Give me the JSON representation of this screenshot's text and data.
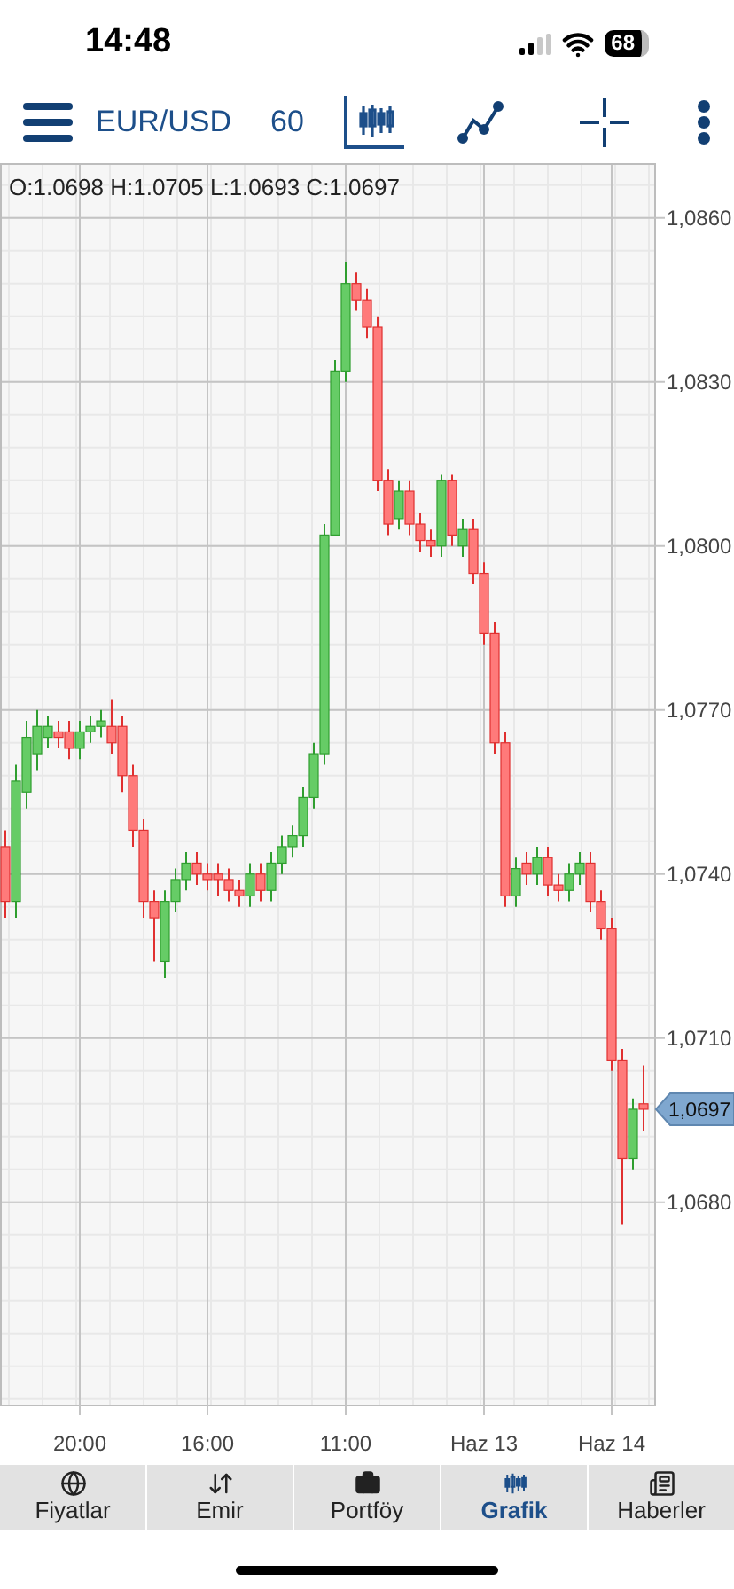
{
  "status_bar": {
    "time": "14:48",
    "battery": "68"
  },
  "toolbar": {
    "symbol": "EUR/USD",
    "interval": "60"
  },
  "chart": {
    "ohlc_label": "O:1.0698 H:1.0705 L:1.0693 C:1.0697",
    "last_price": "1,0697",
    "price_labels": [
      "1,0860",
      "1,0830",
      "1,0800",
      "1,0770",
      "1,0740",
      "1,0710",
      "1,0680"
    ],
    "time_labels": [
      "20:00",
      "16:00",
      "11:00",
      "Haz 13",
      "Haz 14"
    ]
  },
  "tabs": [
    {
      "label": "Fiyatlar",
      "kind": "globe",
      "selected": false
    },
    {
      "label": "Emir",
      "kind": "arrows",
      "selected": false
    },
    {
      "label": "Portföy",
      "kind": "briefcase",
      "selected": false
    },
    {
      "label": "Grafik",
      "kind": "chart",
      "selected": true
    },
    {
      "label": "Haberler",
      "kind": "news",
      "selected": false
    }
  ]
}
